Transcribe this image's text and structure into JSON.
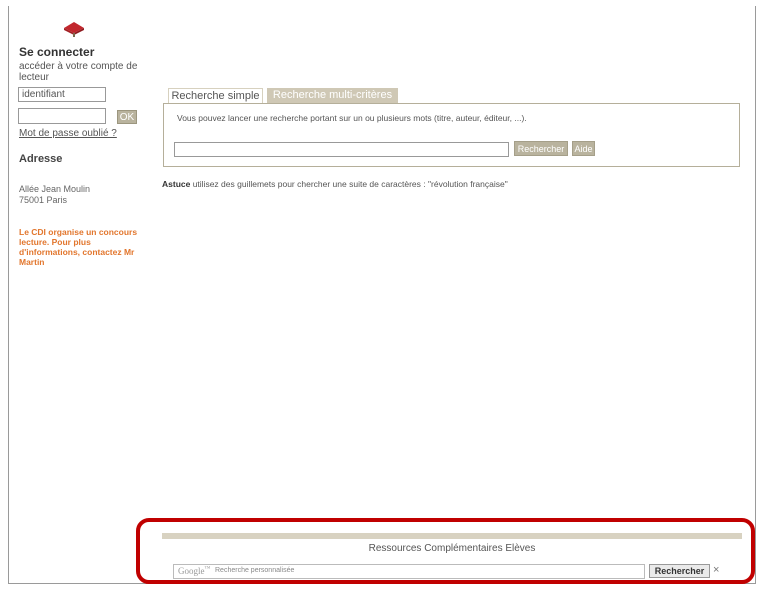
{
  "sidebar": {
    "logo_icon": "red-book-logo-icon",
    "login_title": "Se connecter",
    "login_subtitle": "accéder à votre compte de lecteur",
    "identifiant_value": "identifiant",
    "ok_label": "OK",
    "forgot_password": "Mot de passe oublié ?",
    "address_heading": "Adresse",
    "address_line1": "Allée Jean Moulin",
    "address_line2": "75001 Paris",
    "announcement": "Le CDI organise un concours lecture. Pour plus d'informations, contactez Mr Martin"
  },
  "search": {
    "tabs": [
      {
        "label": "Recherche simple",
        "active": true
      },
      {
        "label": "Recherche multi-critères",
        "active": false
      }
    ],
    "description": "Vous pouvez lancer une recherche portant sur un ou plusieurs mots (titre, auteur, éditeur, ...).",
    "query_value": "",
    "search_button": "Rechercher",
    "help_button": "Aide",
    "tip_label": "Astuce",
    "tip_text": " utilisez des guillemets pour chercher une suite de caractères : \"révolution française\""
  },
  "footer": {
    "title": "Ressources Complémentaires Elèves",
    "google_logo": "Google",
    "google_tm": "™",
    "google_placeholder": "Recherche personnalisée",
    "google_button": "Rechercher",
    "close_icon": "×"
  },
  "colors": {
    "accent_beige": "#b9b39e",
    "tab_inactive": "#cfc8b5",
    "highlight_red": "#c00000",
    "announcement_orange": "#e2762d"
  }
}
